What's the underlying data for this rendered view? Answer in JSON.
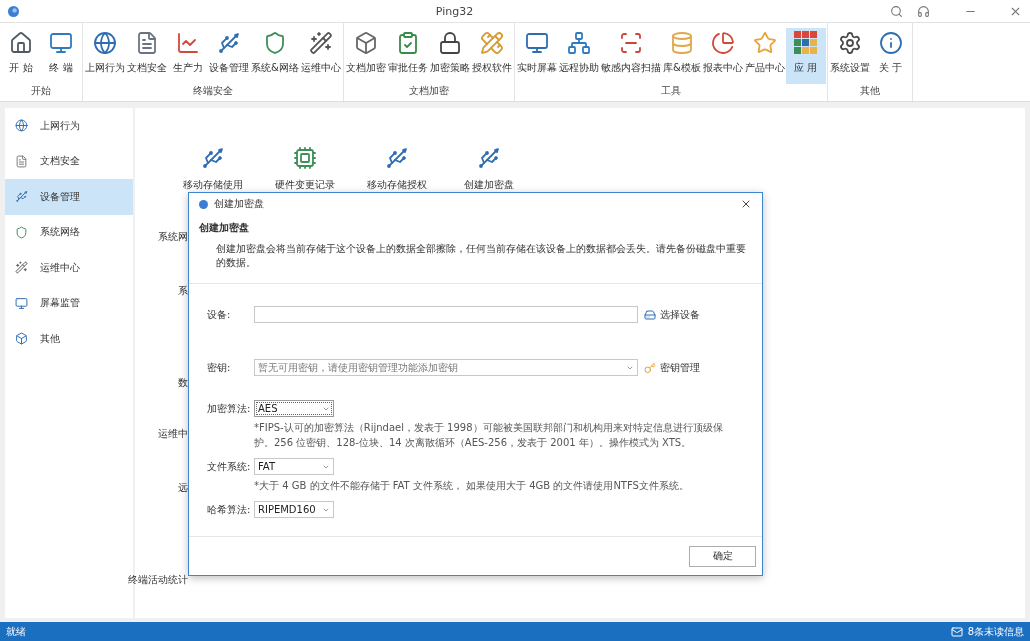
{
  "window": {
    "title": "Ping32"
  },
  "ribbon": {
    "groups": [
      {
        "label": "开始",
        "buttons": [
          {
            "label": "开 始",
            "selected": false
          },
          {
            "label": "终 端",
            "selected": false
          }
        ]
      },
      {
        "label": "终端安全",
        "buttons": [
          {
            "label": "上网行为",
            "selected": false
          },
          {
            "label": "文档安全",
            "selected": false
          },
          {
            "label": "生产力",
            "selected": false
          },
          {
            "label": "设备管理",
            "selected": false
          },
          {
            "label": "系统&网络",
            "selected": false
          },
          {
            "label": "运维中心",
            "selected": false
          }
        ]
      },
      {
        "label": "文档加密",
        "buttons": [
          {
            "label": "文档加密",
            "selected": false
          },
          {
            "label": "审批任务",
            "selected": false
          },
          {
            "label": "加密策略",
            "selected": false
          },
          {
            "label": "授权软件",
            "selected": false
          }
        ]
      },
      {
        "label": "工具",
        "buttons": [
          {
            "label": "实时屏幕",
            "selected": false
          },
          {
            "label": "远程协助",
            "selected": false
          },
          {
            "label": "敏感内容扫描",
            "selected": false
          },
          {
            "label": "库&模板",
            "selected": false
          },
          {
            "label": "报表中心",
            "selected": false
          },
          {
            "label": "产品中心",
            "selected": false
          },
          {
            "label": "应 用",
            "selected": true
          }
        ]
      },
      {
        "label": "其他",
        "buttons": [
          {
            "label": "系统设置",
            "selected": false
          },
          {
            "label": "关 于",
            "selected": false
          }
        ]
      }
    ]
  },
  "sidebar": {
    "items": [
      {
        "label": "上网行为",
        "selected": false
      },
      {
        "label": "文档安全",
        "selected": false
      },
      {
        "label": "设备管理",
        "selected": true
      },
      {
        "label": "系统网络",
        "selected": false
      },
      {
        "label": "运维中心",
        "selected": false
      },
      {
        "label": "屏幕监管",
        "selected": false
      },
      {
        "label": "其他",
        "selected": false
      }
    ]
  },
  "content": {
    "tiles": [
      {
        "label": "移动存储使用"
      },
      {
        "label": "硬件变更记录"
      },
      {
        "label": "移动存储授权"
      },
      {
        "label": "创建加密盘"
      }
    ],
    "labels": [
      "系统网",
      "系",
      "数",
      "运维中",
      "远",
      "终端活动统计"
    ]
  },
  "dialog": {
    "title": "创建加密盘",
    "heading": "创建加密盘",
    "description": "创建加密盘会将当前存储于这个设备上的数据全部擦除，任何当前存储在该设备上的数据都会丢失。请先备份磁盘中重要的数据。",
    "fields": [
      {
        "kind": "input",
        "label": "设备:",
        "action": "选择设备"
      },
      {
        "kind": "dropdown",
        "label": "密钥:",
        "placeholder": "暂无可用密钥，请使用密钥管理功能添加密钥",
        "action": "密钥管理"
      },
      {
        "kind": "dropdown",
        "label": "加密算法:",
        "value": "AES",
        "focused": true,
        "note": "*FIPS-认可的加密算法（Rijndael，发表于 1998）可能被美国联邦部门和机构用来对特定信息进行顶级保护。256 位密钥、128-位块、14 次离散循环（AES-256，发表于 2001 年）。操作模式为 XTS。"
      },
      {
        "kind": "dropdown",
        "label": "文件系统:",
        "value": "FAT",
        "focused": false,
        "note": "*大于 4 GB 的文件不能存储于 FAT 文件系统， 如果使用大于 4GB 的文件请使用NTFS文件系统。"
      },
      {
        "kind": "dropdown",
        "label": "哈希算法:",
        "value": "RIPEMD160",
        "focused": false
      }
    ],
    "button": "确定"
  },
  "status_bar": {
    "text": "就绪",
    "messages": "8条未读信息"
  }
}
